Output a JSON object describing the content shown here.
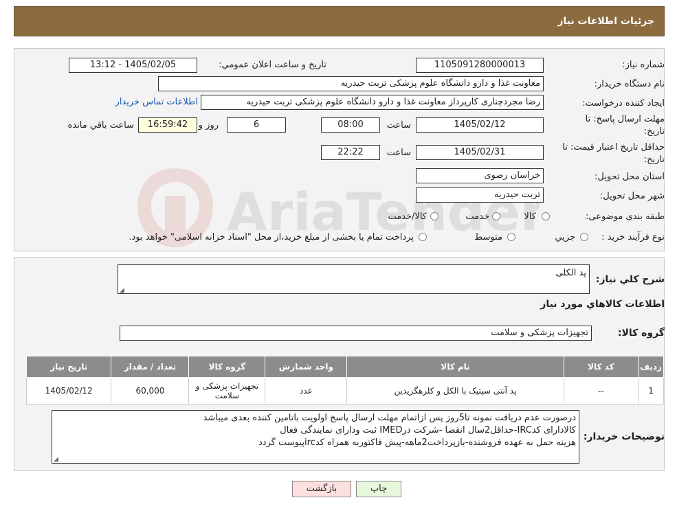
{
  "header": {
    "title": "جزئيات اطلاعات نیاز"
  },
  "form": {
    "need_number_label": "شماره نیاز:",
    "need_number": "1105091280000013",
    "announce_label": "تاریخ و ساعت اعلان عمومي:",
    "announce_value": "1405/02/05 - 13:12",
    "buyer_org_label": "نام دستگاه خريدار:",
    "buyer_org": "معاونت غذا و دارو   دانشگاه علوم پزشکی تربت حیدریه",
    "creator_label": "ايجاد كننده درخواست:",
    "creator": "رضا مجردچناری کارپرداز معاونت غذا و دارو   دانشگاه علوم پزشکی تربت حیدریه",
    "contact_link": "اطلاعات تماس خريدار",
    "deadline_label_1": "مهلت ارسال پاسخ: تا",
    "deadline_label_2": "تاريخ:",
    "deadline_date": "1405/02/12",
    "time_label": "ساعت",
    "deadline_time": "08:00",
    "days_value": "6",
    "days_label": "روز و",
    "remaining_time": "16:59:42",
    "remaining_label": "ساعت باقي مانده",
    "validity_label_1": "حداقل تاريخ اعتبار قيمت: تا",
    "validity_label_2": "تاريخ:",
    "validity_date": "1405/02/31",
    "validity_time": "22:22",
    "province_label": "استان محل تحويل:",
    "province": "خراسان رضوی",
    "city_label": "شهر محل تحويل:",
    "city": "تربت حیدریه",
    "category_label": "طبقه بندی موضوعی:",
    "category_options": [
      "كالا",
      "خدمت",
      "كالا/خدمت"
    ],
    "process_label": "نوع فرآيند خريد :",
    "process_options": [
      "جزيي",
      "متوسط"
    ],
    "process_note": "پرداخت تمام يا بخشی از مبلغ خريد،از محل \"اسناد خزانه اسلامی\" خواهد بود."
  },
  "description": {
    "label": "شرح كلي نياز:",
    "value": "پد الکلی",
    "goods_info_title": "اطلاعات كالاهاي مورد نياز",
    "group_label": "گروه كالا:",
    "group_value": "تجهیزات پزشکی و سلامت"
  },
  "table": {
    "headers": [
      "رديف",
      "كد كالا",
      "نام كالا",
      "واحد شمارش",
      "گروه كالا",
      "تعداد / مقدار",
      "تاريخ نياز"
    ],
    "rows": [
      [
        "1",
        "--",
        "پد آنتی سپتیک با الکل و کلرهگزیدین",
        "عدد",
        "تجهیزات پزشکی و سلامت",
        "60,000",
        "1405/02/12"
      ]
    ]
  },
  "buyer_notes": {
    "label": "توضيحات خريدار:",
    "lines": [
      "درصورت عدم دریافت نمونه تا5روز پس ازاتمام مهلت ارسال پاسخ اولویت باتامین کننده بعدی میباشد",
      "کالادارای کدIRC-حداقل2سال انقضا -شرکت درIMED ثبت ودارای نمایندگی فعال",
      "هزینه حمل به عهده فروشنده-بازپرداخت2ماهه-پیش فاکتوربه همراه کدircپیوست گردد"
    ]
  },
  "buttons": {
    "print": "چاپ",
    "back": "بازگشت"
  },
  "watermark": {
    "text": "AriaTender.neT"
  },
  "colors": {
    "header_bg": "#8c6b3f",
    "print_bg": "#e6f7dc",
    "back_bg": "#fbe0df",
    "table_header_bg": "#8c8c8c",
    "link": "#1a5bb5"
  }
}
